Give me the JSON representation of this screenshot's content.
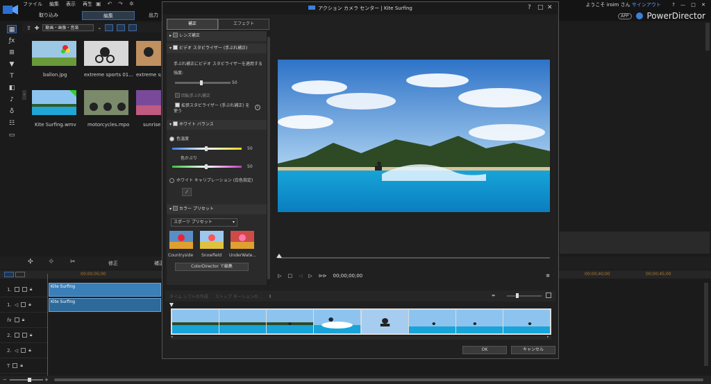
{
  "menu": [
    "ファイル",
    "編集",
    "表示",
    "再生"
  ],
  "mode_tabs": [
    "取り込み",
    "編集",
    "出力"
  ],
  "user": {
    "welcome": "ようこそ iroim さん",
    "signout": "サインアウト"
  },
  "app": {
    "badge": "APP",
    "name": "PowerDirector"
  },
  "library": {
    "filter": "動画・画像・音楽",
    "items": [
      {
        "label": "ballon.jpg"
      },
      {
        "label": "extreme sports 01..."
      },
      {
        "label": "extreme sp"
      },
      {
        "label": "Kite Surfing.wmv"
      },
      {
        "label": "motorcycles.mpo"
      },
      {
        "label": "sunrise"
      }
    ]
  },
  "edit_toolbar": {
    "modify": "修正",
    "correction": "補正"
  },
  "timeline": {
    "ticks": [
      "00;00;05;00",
      "00;00;40;00",
      "00;00;45;00"
    ],
    "tracks": [
      "1.",
      "1.",
      "fx",
      "2.",
      "2.",
      "T",
      ""
    ],
    "clips": [
      "Kite Surfing",
      "Kite Surfing"
    ]
  },
  "dialog": {
    "title": "アクション カメラ センター  |  Kite Surfing",
    "controls": [
      "?",
      "□",
      "✕"
    ],
    "tabs": [
      "補正",
      "エフェクト"
    ],
    "lens": "レンズ補正",
    "stabilizer": {
      "header": "ビデオ スタビライザー (手ぶれ補正)",
      "desc": "手ぶれ補正にビデオ スタビライザーを適用する",
      "strength_label": "強度:",
      "strength": 50,
      "rotation": "回転手ぶれ補正",
      "enhanced": "拡張スタビライザー (手ぶれ補正) を使う"
    },
    "white_balance": {
      "header": "ホワイト バランス",
      "color_temp": "色温度",
      "color_temp_value": 50,
      "tint": "色かぶり",
      "tint_value": 50,
      "calibration": "ホワイト キャリブレーション (白色指定)"
    },
    "color_preset": {
      "header": "カラー プリセット",
      "select": "スポーツ プリセット",
      "presets": [
        "Countryside",
        "Snowfield",
        "UnderWate..."
      ],
      "edit_button": "ColorDirector で編集"
    },
    "playback": {
      "time": "00;00;00;00"
    },
    "freeze_bar": {
      "freeze": "タイム シフトの作成",
      "stop": "ストップ モーションの..."
    },
    "ok": "OK",
    "cancel": "キャンセル"
  },
  "colors": {
    "accent": "#3d6aa0",
    "clip": "#3a7fb8",
    "playhead": "#c03030"
  }
}
